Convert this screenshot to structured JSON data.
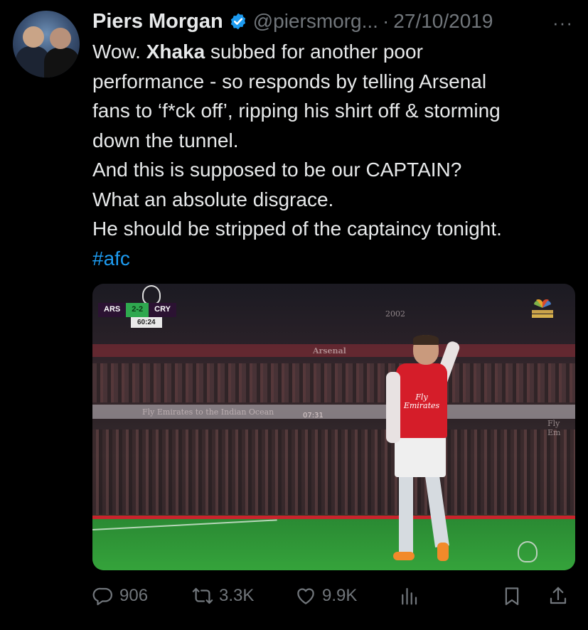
{
  "author": {
    "name": "Piers Morgan",
    "handle": "@piersmorg...",
    "separator": "·",
    "date": "27/10/2019",
    "verified": true,
    "avatar_icon": "avatar-two-men"
  },
  "more_label": "···",
  "tweet": {
    "lines": [
      {
        "pre": "Wow. ",
        "bold": "Xhaka",
        "post": " subbed for another poor"
      },
      {
        "text": "performance - so responds by telling Arsenal"
      },
      {
        "text": "fans to ‘f*ck off’, ripping his shirt off & storming"
      },
      {
        "text": "down the tunnel."
      },
      {
        "text": "And this is supposed to be our CAPTAIN?"
      },
      {
        "text": "What an absolute disgrace."
      },
      {
        "text": "He should be stripped of the captaincy tonight."
      }
    ],
    "hashtag": "#afc"
  },
  "media": {
    "scoreboard": {
      "home": "ARS",
      "score": "2-2",
      "away": "CRY",
      "clock": "60:24"
    },
    "shirt_sponsor_line1": "Fly",
    "shirt_sponsor_line2": "Emirates",
    "ad_text_1": "Fly Emirates to the Indian Ocean",
    "ad_text_2": "Arsenal",
    "ad_text_3": "2002",
    "ad_text_4": "Fly Em",
    "ad_text_5": "07:31"
  },
  "actions": {
    "replies": "906",
    "reposts": "3.3K",
    "likes": "9.9K",
    "icons": [
      "reply-icon",
      "repost-icon",
      "like-icon",
      "views-icon",
      "bookmark-icon",
      "share-icon"
    ]
  },
  "colors": {
    "background": "#000000",
    "text": "#e7e9ea",
    "muted": "#71767b",
    "link": "#1d9bf0",
    "verified": "#1d9bf0"
  }
}
